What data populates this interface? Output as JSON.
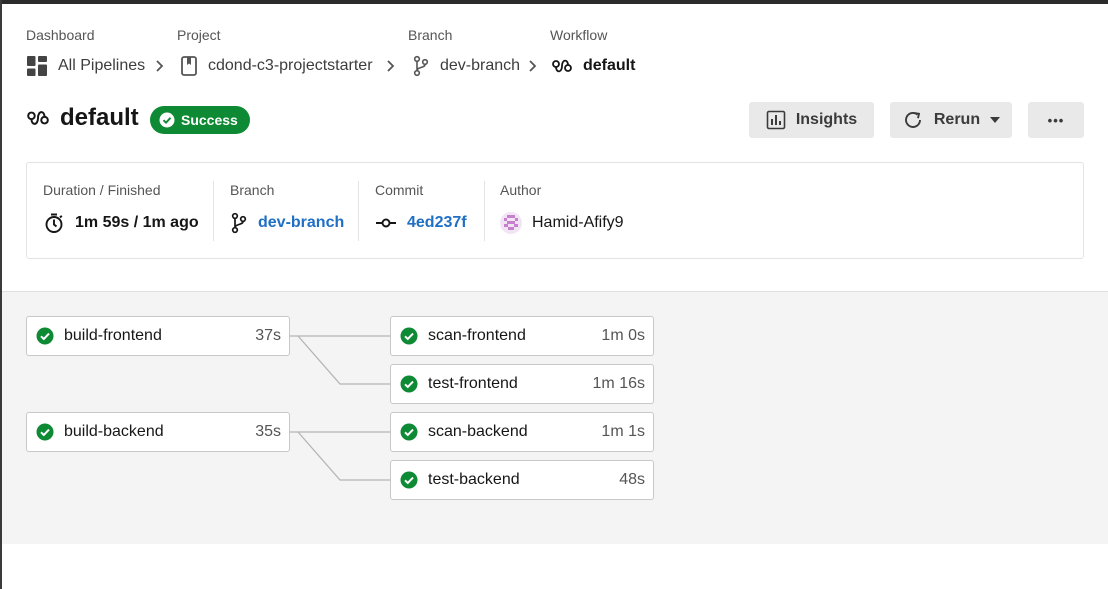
{
  "breadcrumb": {
    "labels": [
      "Dashboard",
      "Project",
      "Branch",
      "Workflow"
    ],
    "dashboard": "All Pipelines",
    "project": "cdond-c3-projectstarter",
    "branch": "dev-branch",
    "workflow": "default"
  },
  "header": {
    "title": "default",
    "status": "Success",
    "status_color": "#0e8a34",
    "insights_label": "Insights",
    "rerun_label": "Rerun",
    "more_label": "•••"
  },
  "summary": {
    "duration_label": "Duration / Finished",
    "duration_value": "1m 59s / 1m ago",
    "branch_label": "Branch",
    "branch_value": "dev-branch",
    "commit_label": "Commit",
    "commit_value": "4ed237f",
    "author_label": "Author",
    "author_value": "Hamid-Afify9",
    "link_color": "#1f6fc5"
  },
  "jobs": [
    {
      "name": "build-frontend",
      "duration": "37s",
      "status": "success"
    },
    {
      "name": "build-backend",
      "duration": "35s",
      "status": "success"
    },
    {
      "name": "scan-frontend",
      "duration": "1m 0s",
      "status": "success"
    },
    {
      "name": "test-frontend",
      "duration": "1m 16s",
      "status": "success"
    },
    {
      "name": "scan-backend",
      "duration": "1m 1s",
      "status": "success"
    },
    {
      "name": "test-backend",
      "duration": "48s",
      "status": "success"
    }
  ],
  "icons": {
    "dashboard": "grid-icon",
    "project": "bookmark-icon",
    "branch": "git-branch-icon",
    "workflow": "workflow-icon",
    "success": "check-circle-icon",
    "timer": "stopwatch-icon",
    "commit": "git-commit-icon",
    "insights": "bar-chart-icon",
    "rerun": "refresh-icon"
  }
}
